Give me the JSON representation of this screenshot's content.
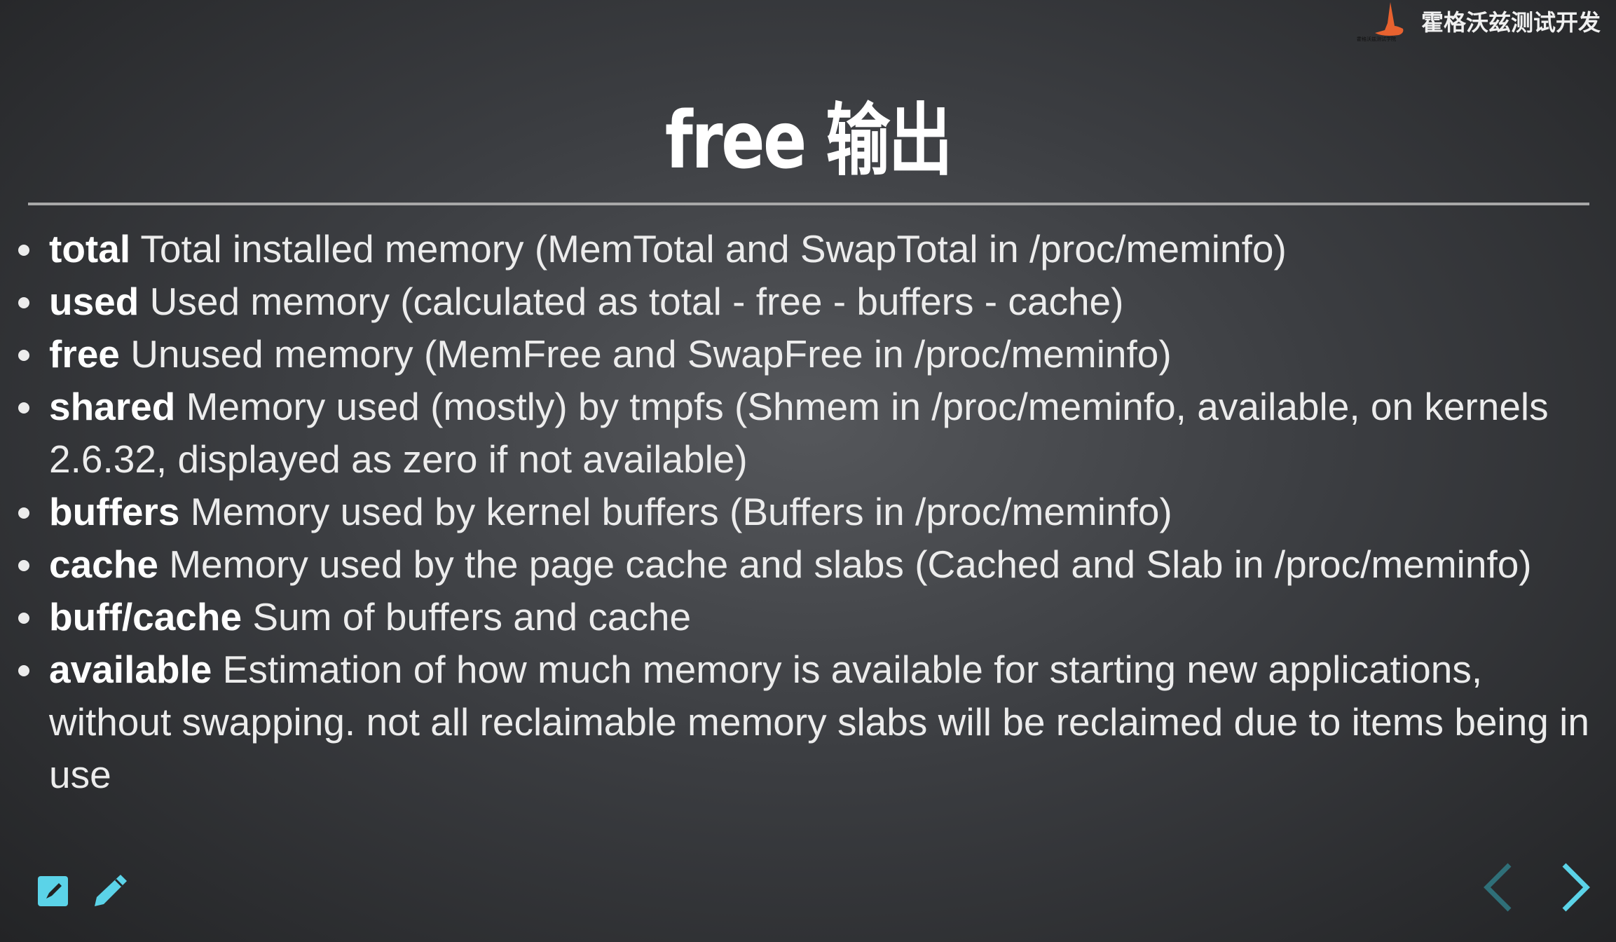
{
  "logo": {
    "brand": "霍格沃兹测试开发",
    "subtext": "霍格沃兹测试学院"
  },
  "title": "free 输出",
  "items": [
    {
      "term": "total",
      "desc": "Total installed memory (MemTotal and SwapTotal in /proc/meminfo)"
    },
    {
      "term": "used",
      "desc": "Used memory (calculated as total - free - buffers - cache)"
    },
    {
      "term": "free",
      "desc": "Unused memory (MemFree and SwapFree in /proc/meminfo)"
    },
    {
      "term": "shared",
      "desc": "Memory used (mostly) by tmpfs (Shmem in /proc/meminfo, available, on kernels 2.6.32, displayed as zero if not available)"
    },
    {
      "term": "buffers",
      "desc": "Memory used by kernel buffers (Buffers in /proc/meminfo)"
    },
    {
      "term": "cache",
      "desc": "Memory used by the page cache and slabs (Cached and Slab in /proc/meminfo)"
    },
    {
      "term": "buff/cache",
      "desc": "Sum of buffers and cache"
    },
    {
      "term": "available",
      "desc": "Estimation of how much memory is available for starting new applications, without swapping. not all reclaimable memory slabs will be reclaimed due to items being in use"
    }
  ],
  "colors": {
    "accent": "#5bd3e8",
    "disabled": "#2f6f78"
  }
}
